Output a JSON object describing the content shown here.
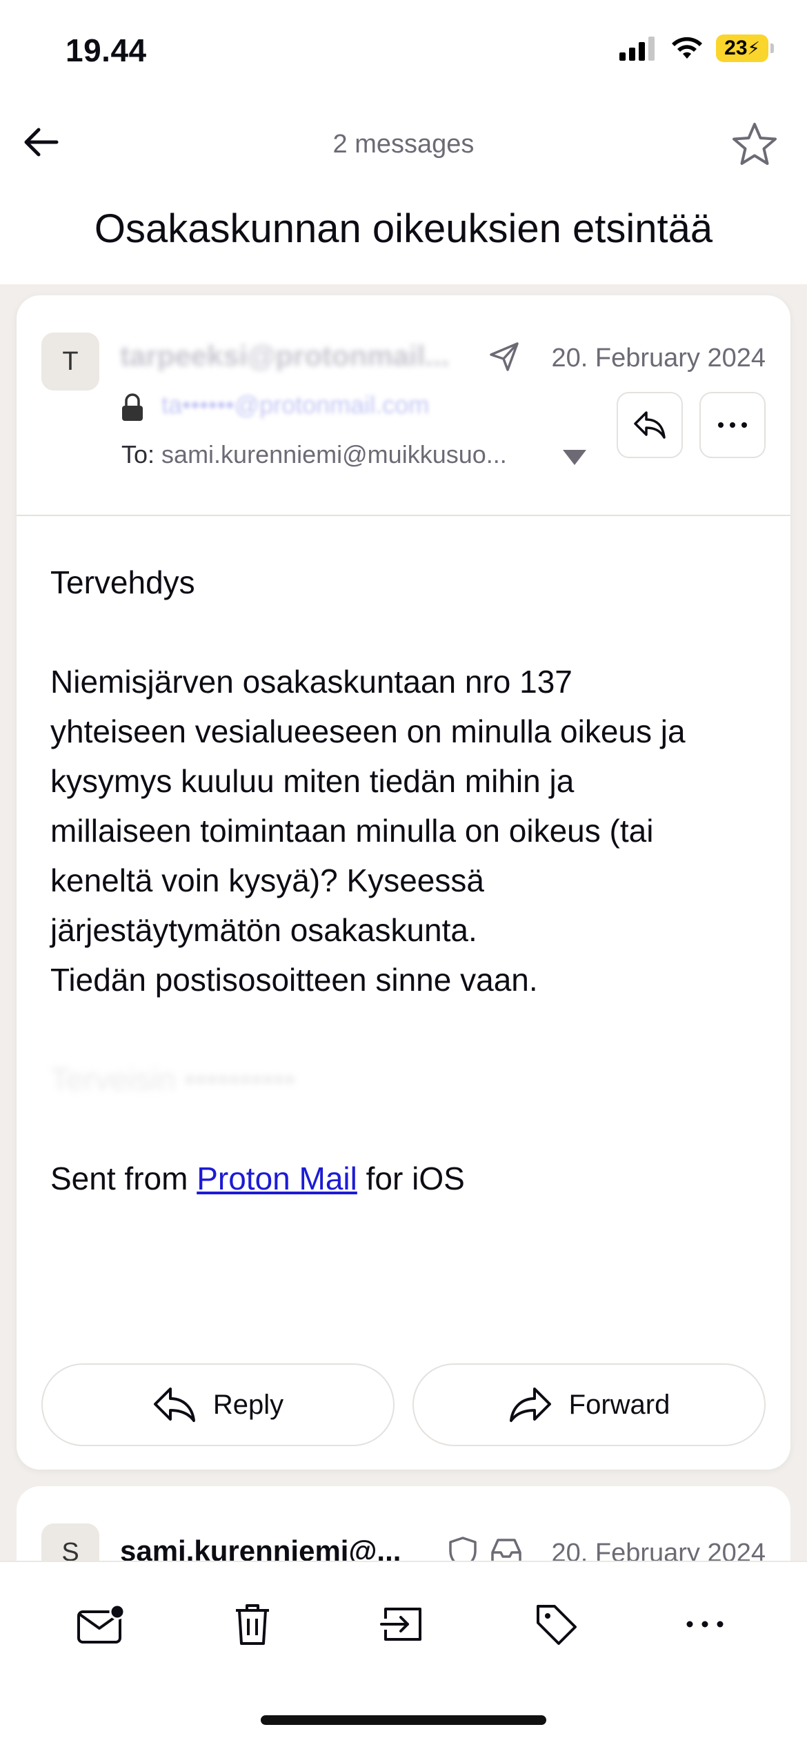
{
  "status_bar": {
    "time": "19.44",
    "battery": "23"
  },
  "header": {
    "message_count": "2 messages",
    "subject": "Osakaskunnan oikeuksien etsintää"
  },
  "message1": {
    "avatar_initial": "T",
    "sender_redacted": "tarpeeksi@protonmail...",
    "date": "20. February 2024",
    "address_redacted": "ta••••••@protonmail.com",
    "to_label": "To:",
    "to_value": "sami.kurenniemi@muikkusuo...",
    "body": {
      "greeting": "Tervehdys",
      "paragraph_lines": [
        "Niemisjärven osakaskuntaan nro 137",
        "yhteiseen vesialueeseen on minulla oikeus ja",
        "kysymys kuuluu miten tiedän mihin ja",
        "millaiseen toimintaan minulla on oikeus (tai",
        "keneltä voin kysyä)? Kyseessä",
        "järjestäytymätön osakaskunta.",
        "Tiedän postisosoitteen sinne vaan."
      ],
      "signature_redacted": "Terveisin ••••••••••",
      "sent_from_prefix": "Sent from ",
      "sent_from_link": "Proton Mail",
      "sent_from_suffix": " for iOS"
    },
    "reply_label": "Reply",
    "forward_label": "Forward"
  },
  "message2": {
    "avatar_initial": "S",
    "sender": "sami.kurenniemi@...",
    "date": "20. February 2024"
  },
  "icons": {
    "back": "arrow-left-icon",
    "star": "star-icon",
    "sent": "paper-plane-icon",
    "lock": "lock-icon",
    "reply": "reply-icon",
    "more": "ellipsis-icon",
    "dropdown": "chevron-down-icon",
    "shield": "shield-icon",
    "inbox": "inbox-icon",
    "mark_unread": "envelope-unread-icon",
    "trash": "trash-icon",
    "move": "move-to-folder-icon",
    "label": "tag-icon",
    "more_actions": "ellipsis-icon"
  },
  "colors": {
    "background": "#f1eeeb",
    "card": "#ffffff",
    "text_primary": "#0c0c14",
    "text_secondary": "#6d6a75",
    "link": "#1c1bd4",
    "battery": "#fad52b"
  }
}
